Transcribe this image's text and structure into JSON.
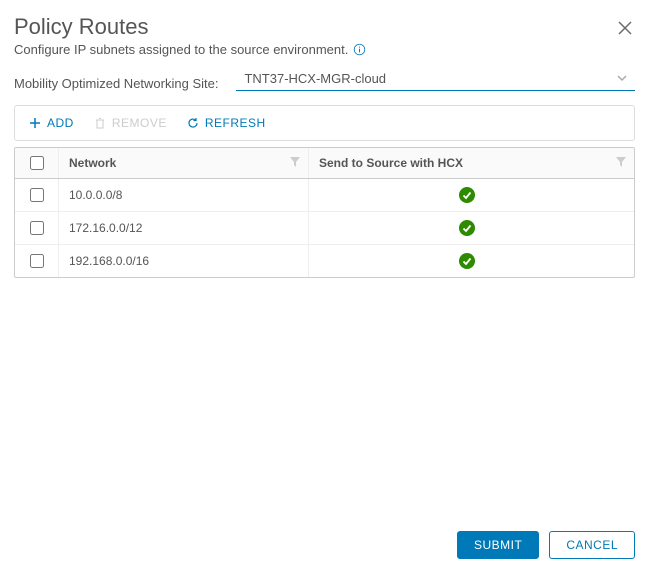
{
  "header": {
    "title": "Policy Routes",
    "subtitle": "Configure IP subnets assigned to the source environment."
  },
  "site": {
    "label": "Mobility Optimized Networking Site:",
    "value": "TNT37-HCX-MGR-cloud"
  },
  "toolbar": {
    "add": "ADD",
    "remove": "REMOVE",
    "refresh": "REFRESH"
  },
  "table": {
    "columns": {
      "network": "Network",
      "hcx": "Send to Source with HCX"
    },
    "rows": [
      {
        "network": "10.0.0.0/8",
        "hcx": true
      },
      {
        "network": "172.16.0.0/12",
        "hcx": true
      },
      {
        "network": "192.168.0.0/16",
        "hcx": true
      }
    ]
  },
  "footer": {
    "submit": "SUBMIT",
    "cancel": "CANCEL"
  }
}
